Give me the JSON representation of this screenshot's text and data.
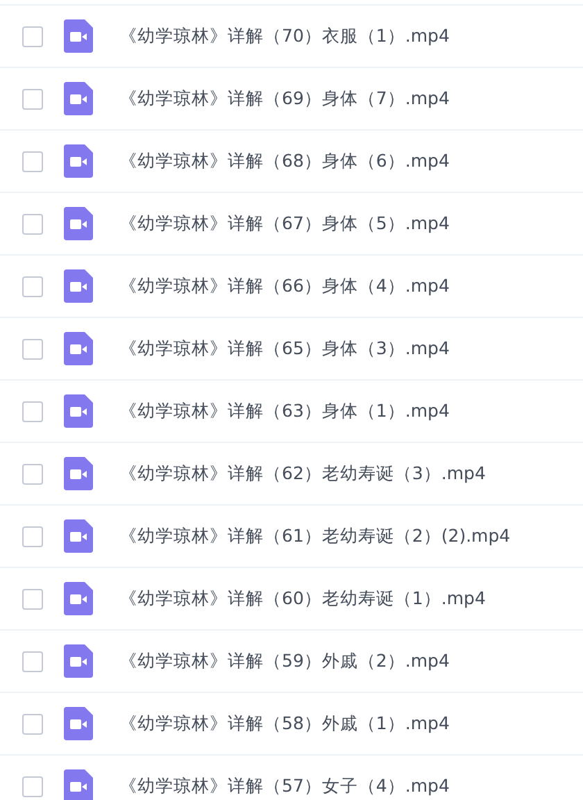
{
  "files": [
    {
      "name": "《幼学琼林》详解（70）衣服（1）.mp4",
      "checked": false
    },
    {
      "name": "《幼学琼林》详解（69）身体（7）.mp4",
      "checked": false
    },
    {
      "name": "《幼学琼林》详解（68）身体（6）.mp4",
      "checked": false
    },
    {
      "name": "《幼学琼林》详解（67）身体（5）.mp4",
      "checked": false
    },
    {
      "name": "《幼学琼林》详解（66）身体（4）.mp4",
      "checked": false
    },
    {
      "name": "《幼学琼林》详解（65）身体（3）.mp4",
      "checked": false
    },
    {
      "name": "《幼学琼林》详解（63）身体（1）.mp4",
      "checked": false
    },
    {
      "name": "《幼学琼林》详解（62）老幼寿诞（3）.mp4",
      "checked": false
    },
    {
      "name": "《幼学琼林》详解（61）老幼寿诞（2）(2).mp4",
      "checked": false
    },
    {
      "name": "《幼学琼林》详解（60）老幼寿诞（1）.mp4",
      "checked": false
    },
    {
      "name": "《幼学琼林》详解（59）外戚（2）.mp4",
      "checked": false
    },
    {
      "name": "《幼学琼林》详解（58）外戚（1）.mp4",
      "checked": false
    },
    {
      "name": "《幼学琼林》详解（57）女子（4）.mp4",
      "checked": false
    }
  ]
}
